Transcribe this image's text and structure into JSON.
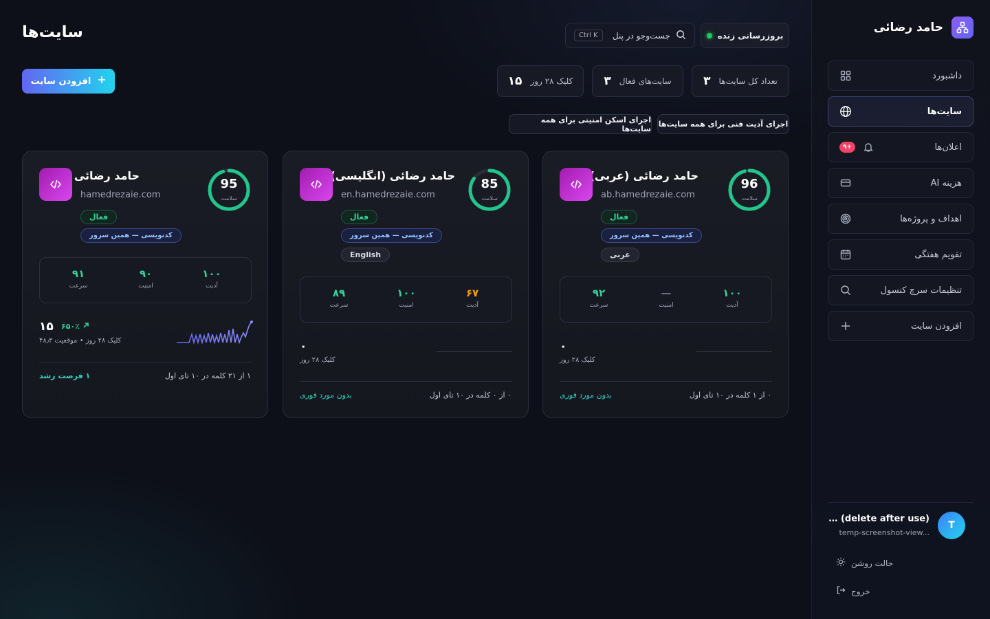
{
  "sidebar": {
    "brand": "حامد رضائی",
    "items": [
      {
        "label": "داشبورد"
      },
      {
        "label": "سایت‌ها"
      },
      {
        "label": "اعلان‌ها",
        "badge": "+۹"
      },
      {
        "label": "هزینه AI"
      },
      {
        "label": "اهداف و پروژه‌ها"
      },
      {
        "label": "تقویم هفتگی"
      },
      {
        "label": "تنظیمات سرچ کنسول"
      },
      {
        "label": "افزودن سایت"
      }
    ],
    "user": {
      "initial": "T",
      "name": "… (delete after use)",
      "email": "temp-screenshot-view..."
    },
    "theme_label": "حالت روشن",
    "logout_label": "خروج"
  },
  "header": {
    "title": "سایت‌ها",
    "add_button": "افزودن سایت",
    "live_button": "بروزرسانی زنده",
    "search_label": "جست‌وجو در پنل",
    "search_shortcut": "Ctrl K"
  },
  "stats": [
    {
      "label": "تعداد کل سایت‌ها",
      "value": "۳"
    },
    {
      "label": "سایت‌های فعال",
      "value": "۳"
    },
    {
      "label": "کلیک ۲۸ روز",
      "value": "۱۵"
    }
  ],
  "actions": {
    "tech_audit": "اجرای آدیت فنی برای همه سایت‌ها",
    "security_scan": "اجرای اسکن امنیتی برای همه سایت‌ها"
  },
  "colors": {
    "accent_green": "#34d399",
    "accent_purple": "#d946ef",
    "accent_blue": "#6366f1"
  },
  "cards": [
    {
      "title": "حامد رضائی (عربی)",
      "domain": "ab.hamedrezaie.com",
      "health": 96,
      "health_label": "سلامت",
      "status": "فعال",
      "server": "کدنویسی — همین سرور",
      "lang": "عربی",
      "metrics": {
        "audit": "۱۰۰",
        "audit_label": "آدیت",
        "security": "—",
        "security_label": "امنیت",
        "speed": "۹۲",
        "speed_label": "سرعت"
      },
      "clicks": "۰",
      "clicks_label": "کلیک ۲۸ روز",
      "foot_right": "۰ از ۱ کلمه در ۱۰ تای اول",
      "foot_left": "بدون مورد فوری"
    },
    {
      "title": "حامد رضائی (انگلیسی)",
      "domain": "en.hamedrezaie.com",
      "health": 85,
      "health_label": "سلامت",
      "status": "فعال",
      "server": "کدنویسی — همین سرور",
      "lang": "English",
      "metrics": {
        "audit": "۶۷",
        "audit_label": "آدیت",
        "security": "۱۰۰",
        "security_label": "امنیت",
        "speed": "۸۹",
        "speed_label": "سرعت"
      },
      "clicks": "۰",
      "clicks_label": "کلیک ۲۸ روز",
      "foot_right": "۰ از ۰ کلمه در ۱۰ تای اول",
      "foot_left": "بدون مورد فوری"
    },
    {
      "title": "حامد رضائی",
      "domain": "hamedrezaie.com",
      "health": 95,
      "health_label": "سلامت",
      "status": "فعال",
      "server": "کدنویسی — همین سرور",
      "metrics": {
        "audit": "۱۰۰",
        "audit_label": "آدیت",
        "security": "۹۰",
        "security_label": "امنیت",
        "speed": "۹۱",
        "speed_label": "سرعت"
      },
      "clicks": "۱۵",
      "growth": "۶۵۰٪",
      "clicks_label": "کلیک ۲۸ روز • موقعیت ۴۸٫۳",
      "foot_right": "۱ از ۲۱ کلمه در ۱۰ تای اول",
      "foot_left": "۱ فرصت رشد"
    }
  ]
}
